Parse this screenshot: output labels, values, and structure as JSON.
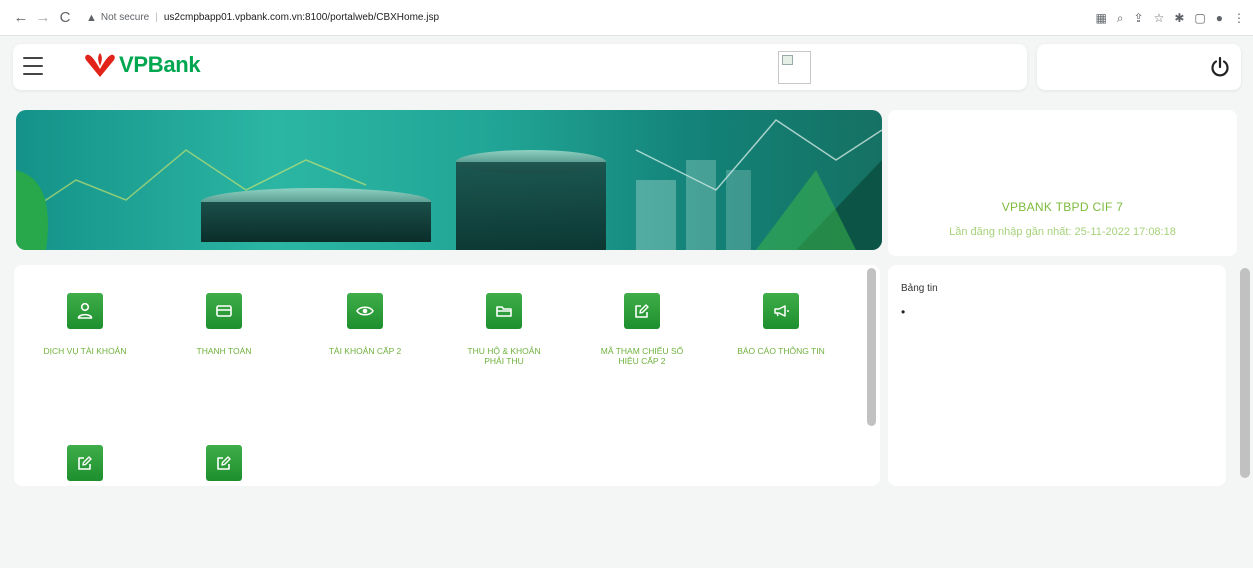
{
  "browser": {
    "back": "←",
    "forward": "→",
    "reload": "C",
    "security": "Not secure",
    "url": "us2cmpbapp01.vpbank.com.vn:8100/portalweb/CBXHome.jsp"
  },
  "header": {
    "brand": "VPBank"
  },
  "user": {
    "name": "VPBANK TBPD CIF 7",
    "last_login": "Lần đăng nhập gần nhất: 25-11-2022 17:08:18"
  },
  "menu": {
    "items": [
      {
        "label": "DỊCH VỤ TÀI KHOẢN",
        "icon": "user-icon"
      },
      {
        "label": "THANH TOÁN",
        "icon": "card-icon"
      },
      {
        "label": "TÀI KHOẢN CẤP 2",
        "icon": "eye-icon"
      },
      {
        "label": "THU HỘ & KHOẢN PHẢI THU",
        "icon": "folder-icon"
      },
      {
        "label": "MÃ THAM CHIẾU SỐ HIỆU CẤP 2",
        "icon": "edit-icon"
      },
      {
        "label": "BÁO CÁO THÔNG TIN",
        "icon": "megaphone-icon"
      },
      {
        "label": "",
        "icon": "edit-icon"
      },
      {
        "label": "",
        "icon": "edit-icon"
      }
    ]
  },
  "news": {
    "title": "Bảng tin",
    "bullet": "•"
  },
  "colors": {
    "brand_green": "#00a650",
    "accent_green": "#3fae49",
    "logo_red": "#e2231a"
  }
}
